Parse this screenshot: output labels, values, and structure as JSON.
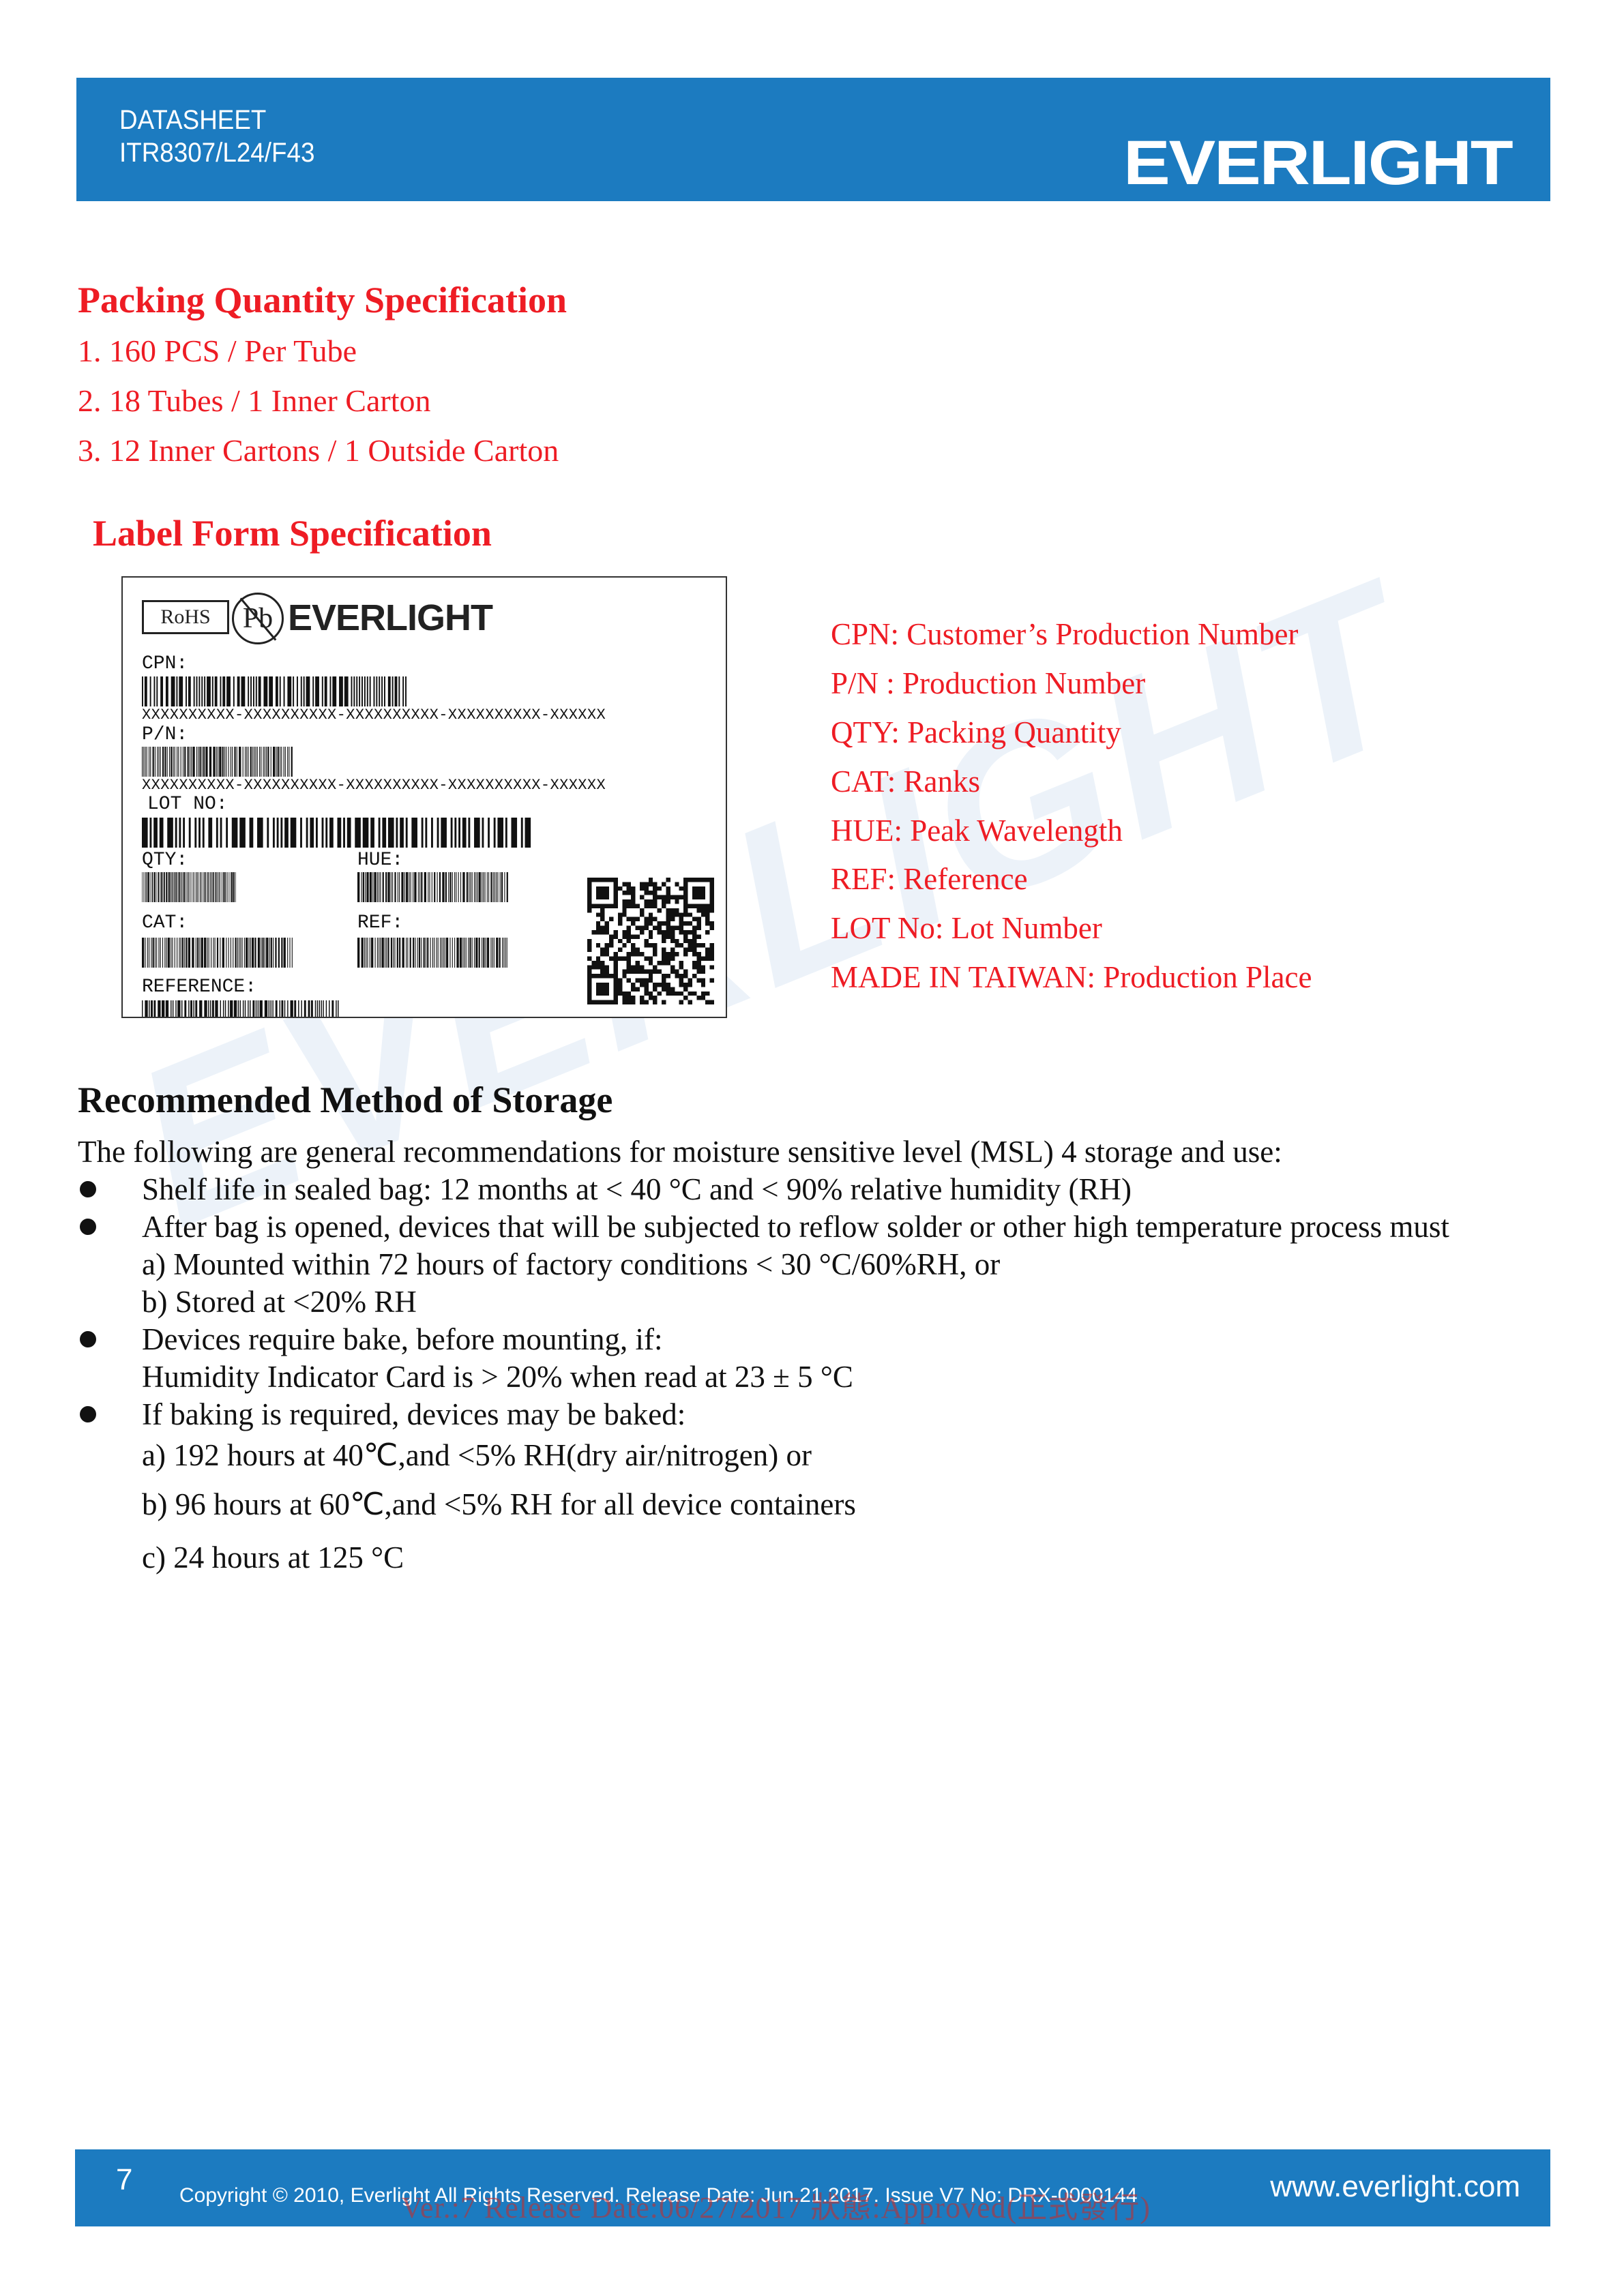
{
  "header": {
    "doc_type": "DATASHEET",
    "part_number": "ITR8307/L24/F43",
    "brand_logo": "EVERLIGHT",
    "background_color": "#1c7bc0"
  },
  "packing": {
    "title": "Packing Quantity Specification",
    "items": [
      "1. 160 PCS / Per Tube",
      "2. 18 Tubes / 1 Inner Carton",
      "3. 12 Inner Cartons / 1 Outside Carton"
    ],
    "color": "#ee1c24"
  },
  "label_form": {
    "title": "Label Form Specification",
    "sample_label": {
      "rohs": "RoHS",
      "pb": "Pb",
      "brand": "EVERLIGHT",
      "fields": {
        "cpn": "CPN:",
        "pn": "P/N:",
        "lot": "LOT NO:",
        "qty": "QTY:",
        "hue": "HUE:",
        "cat": "CAT:",
        "ref": "REF:",
        "reference": "REFERENCE:"
      },
      "placeholder_code": "XXXXXXXXXX-XXXXXXXXXX-XXXXXXXXXX-XXXXXXXXXX-XXXXXX",
      "qr_icon": "qr-code-icon",
      "barcode_icon": "barcode-icon"
    },
    "legend": [
      "CPN: Customer’s Production Number",
      "P/N : Production Number",
      "QTY: Packing Quantity",
      "CAT: Ranks",
      "HUE: Peak Wavelength",
      "REF: Reference",
      "LOT No: Lot Number",
      "MADE IN TAIWAN: Production Place"
    ]
  },
  "storage": {
    "title": "Recommended Method of Storage",
    "intro": "The following are general recommendations for moisture sensitive level (MSL) 4 storage and use:",
    "bullets": [
      {
        "text": "Shelf life in sealed bag: 12 months at < 40 °C and < 90% relative humidity (RH)",
        "sub": []
      },
      {
        "text": "After bag is opened, devices that will be subjected to reflow solder or other high temperature process must",
        "sub": [
          "a) Mounted within 72 hours of factory conditions < 30 °C/60%RH, or",
          "b) Stored at <20% RH"
        ]
      },
      {
        "text": "Devices require bake, before mounting, if:",
        "sub": [
          "Humidity Indicator Card is > 20% when read at 23 ± 5 °C"
        ]
      },
      {
        "text": "If baking is required, devices may be baked:",
        "sub": [
          "a) 192 hours at 40℃,and <5% RH(dry air/nitrogen) or",
          "b) 96 hours at 60℃,and <5% RH for all device containers",
          "c) 24 hours at 125 °C"
        ]
      }
    ],
    "watermark": "EVERLIGHT"
  },
  "footer": {
    "page_number": "7",
    "copyright": "Copyright © 2010, Everlight All Rights Reserved. Release Date: Jun.21.2017. Issue V7 No: DRX-0000144",
    "website": "www.everlight.com",
    "stamp": "Ver.:7    Release Date:06/27/2017    狀態:Approved(正式發行)"
  }
}
